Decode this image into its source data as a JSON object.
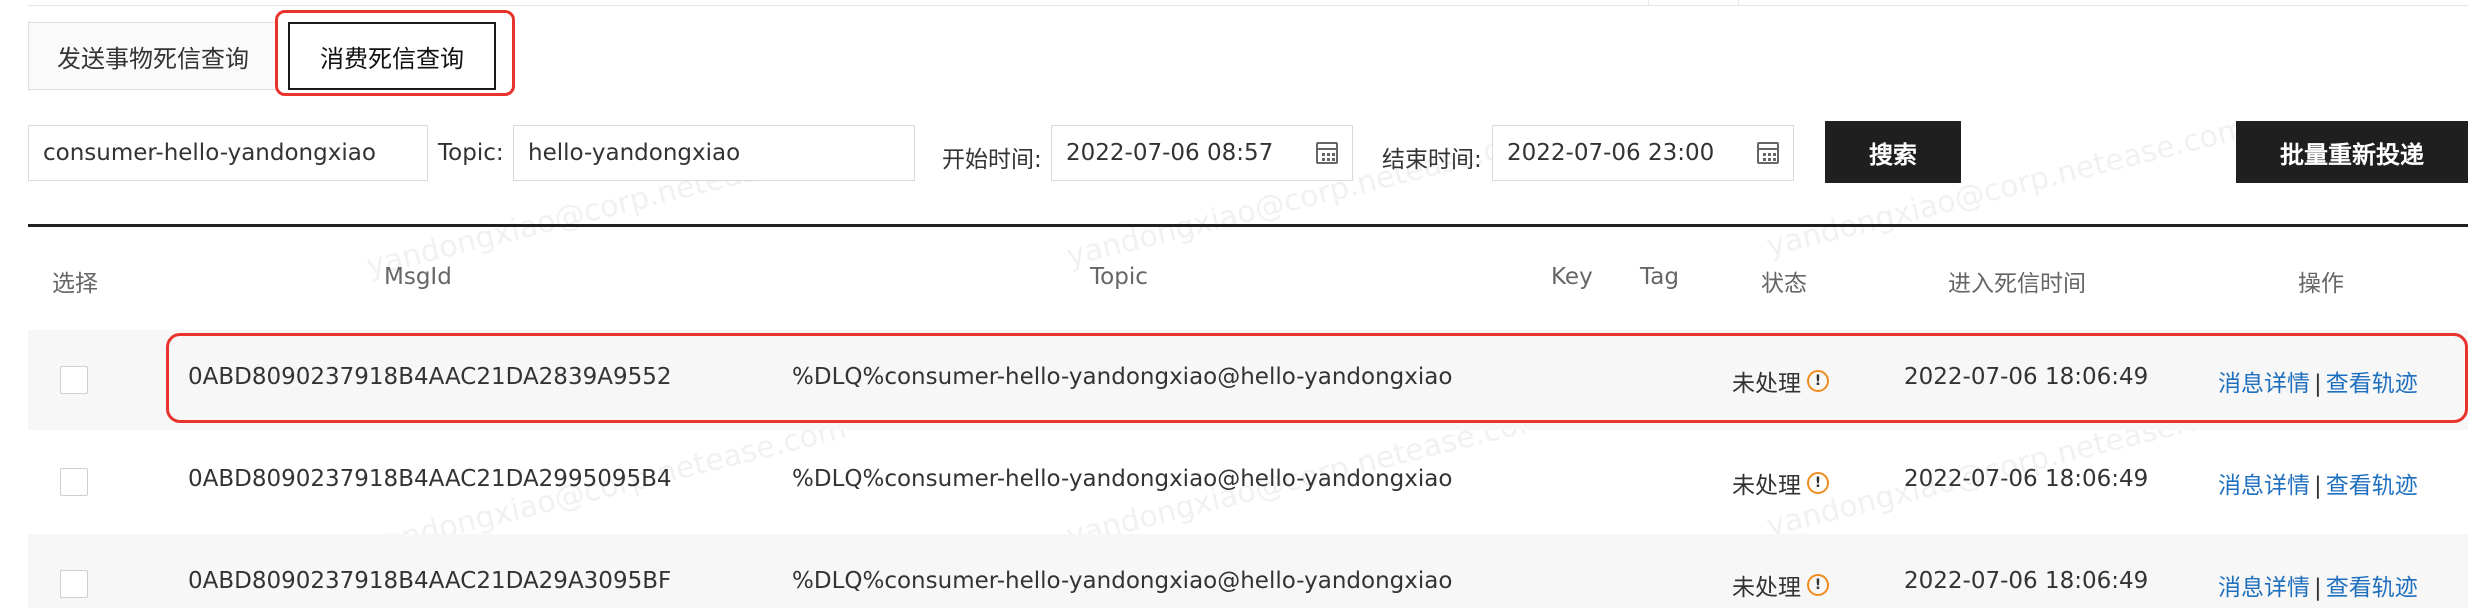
{
  "tabs": [
    {
      "label": "发送事物死信查询",
      "active": false
    },
    {
      "label": "消费死信查询",
      "active": true
    }
  ],
  "filters": {
    "consumer_value": "consumer-hello-yandongxiao",
    "topic_label": "Topic:",
    "topic_value": "hello-yandongxiao",
    "start_label": "开始时间:",
    "start_value": "2022-07-06 08:57",
    "end_label": "结束时间:",
    "end_value": "2022-07-06 23:00",
    "search_button": "搜索",
    "batch_button": "批量重新投递"
  },
  "table": {
    "headers": {
      "select": "选择",
      "msgid": "MsgId",
      "topic": "Topic",
      "key": "Key",
      "tag": "Tag",
      "status": "状态",
      "time": "进入死信时间",
      "actions": "操作"
    },
    "rows": [
      {
        "msgid": "0ABD8090237918B4AAC21DA2839A9552",
        "topic": "%DLQ%consumer-hello-yandongxiao@hello-yandongxiao",
        "key": "",
        "tag": "",
        "status": "未处理",
        "time": "2022-07-06 18:06:49",
        "detail_link": "消息详情",
        "separator": "|",
        "trace_link": "查看轨迹"
      },
      {
        "msgid": "0ABD8090237918B4AAC21DA2995095B4",
        "topic": "%DLQ%consumer-hello-yandongxiao@hello-yandongxiao",
        "key": "",
        "tag": "",
        "status": "未处理",
        "time": "2022-07-06 18:06:49",
        "detail_link": "消息详情",
        "separator": "|",
        "trace_link": "查看轨迹"
      },
      {
        "msgid": "0ABD8090237918B4AAC21DA29A3095BF",
        "topic": "%DLQ%consumer-hello-yandongxiao@hello-yandongxiao",
        "key": "",
        "tag": "",
        "status": "未处理",
        "time": "2022-07-06 18:06:49",
        "detail_link": "消息详情",
        "separator": "|",
        "trace_link": "查看轨迹"
      }
    ]
  },
  "watermark": "yandongxiao@corp.netease.com",
  "colors": {
    "status": "#f08c1e",
    "link": "#1f6fbf",
    "highlight": "#e8342c",
    "button": "#1f1f1f"
  },
  "icons": {
    "status_info": "info-circle-icon",
    "date_picker": "calendar-icon"
  }
}
